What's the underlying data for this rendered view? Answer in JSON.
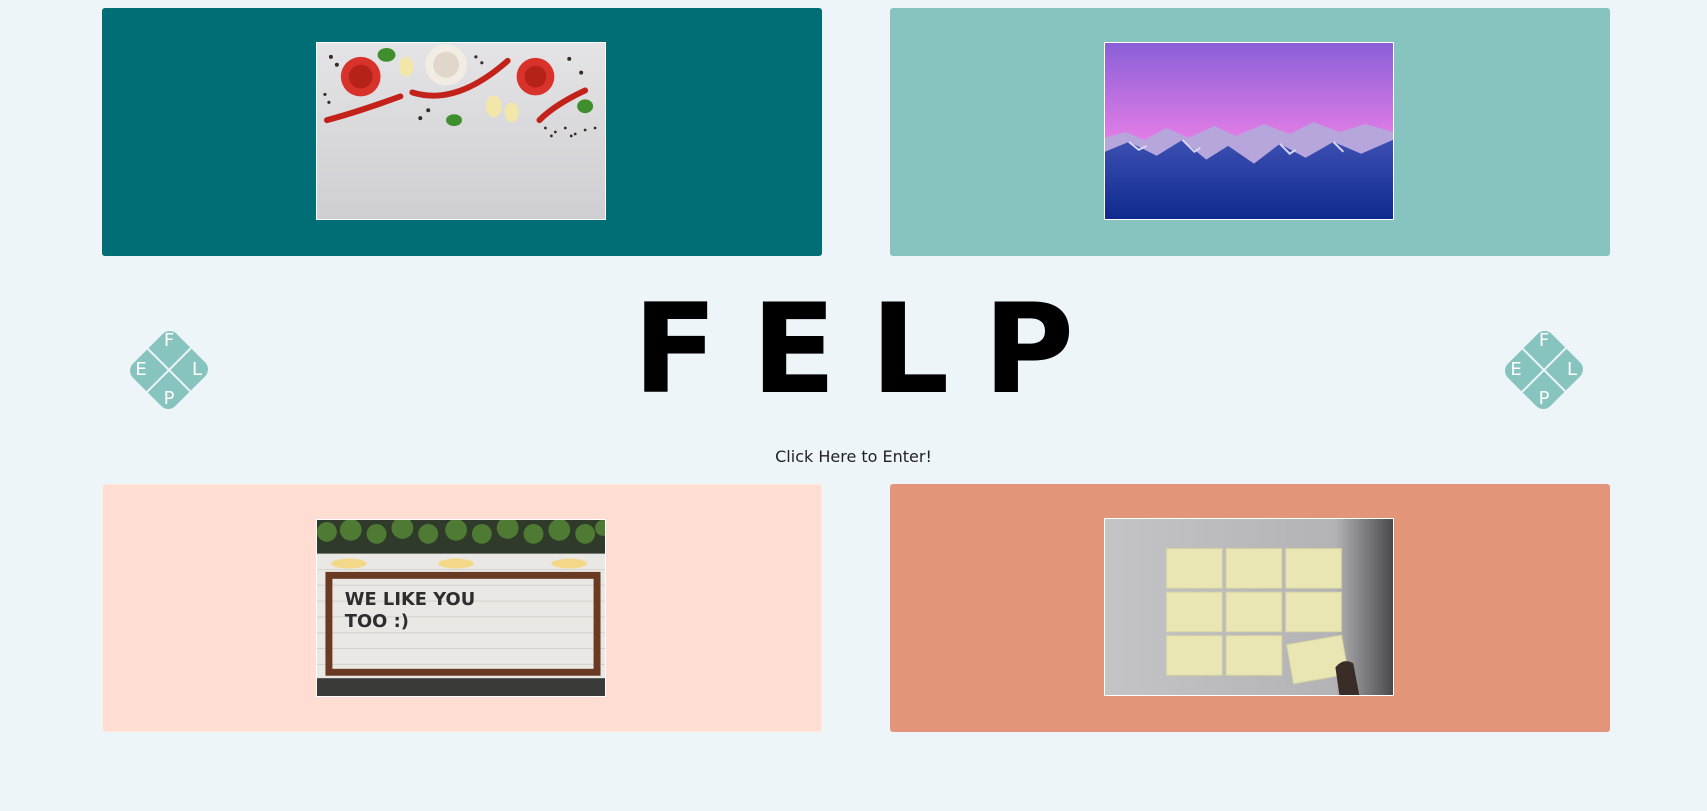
{
  "site": {
    "title": "FELP",
    "enter_link": "Click Here to Enter!"
  },
  "logo": {
    "letters": {
      "top": "F",
      "left": "E",
      "right": "L",
      "bottom": "P"
    },
    "color": "#88c4bf"
  },
  "panels": [
    {
      "id": "top-left",
      "color": "#016e75",
      "photo": "vegetables-and-spices"
    },
    {
      "id": "top-right",
      "color": "#88c4bf",
      "photo": "mountains-at-dusk"
    },
    {
      "id": "bottom-left",
      "color": "#ffddd2",
      "photo": "we-like-you-too-sign"
    },
    {
      "id": "bottom-right",
      "color": "#e29578",
      "photo": "sticky-notes-on-wall"
    }
  ],
  "sign_text": {
    "line1": "WE LIKE YOU",
    "line2": "TOO :)"
  },
  "background": "#edf5f8"
}
